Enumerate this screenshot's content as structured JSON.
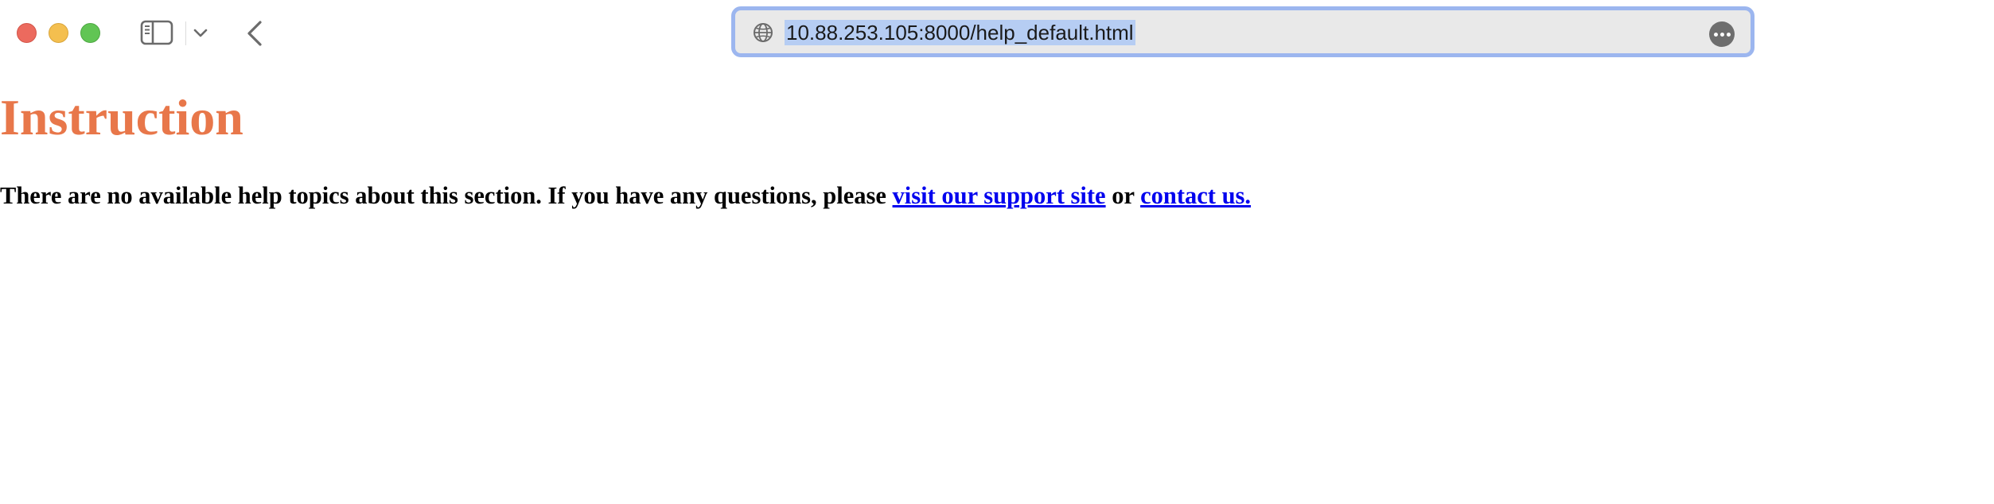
{
  "browser": {
    "url": "10.88.253.105:8000/help_default.html",
    "icons": {
      "sidebar": "sidebar-toggle-icon",
      "chevron": "chevron-down-icon",
      "back": "chevron-left-icon",
      "globe": "globe-icon",
      "more": "ellipsis-icon"
    },
    "colors": {
      "close": "#ec6a5e",
      "minimize": "#f4bf4f",
      "maximize": "#61c554",
      "address_focus_ring": "#9cb6ef",
      "selection": "#b6cdf3"
    }
  },
  "page": {
    "title": "Instruction",
    "title_color": "#e8774a",
    "message_before": "There are no available help topics about this section. If you have any questions, please ",
    "support_link": "visit our support site",
    "conjunction": " or ",
    "contact_link": "contact us.",
    "link_color": "#0000ee"
  }
}
